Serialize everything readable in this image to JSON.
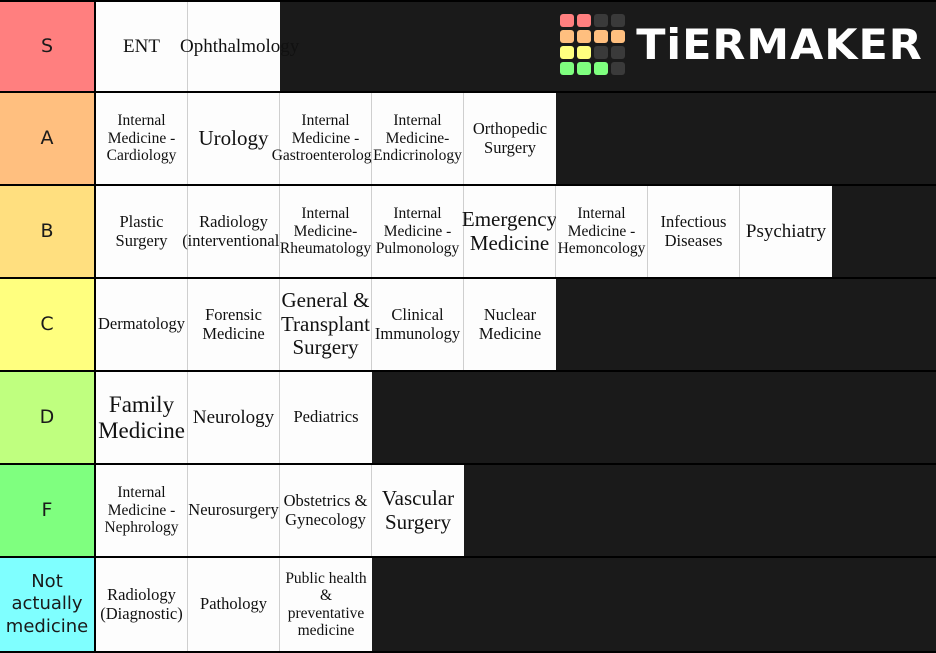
{
  "brand": {
    "name": "TiERMAKER",
    "logo_grid": [
      [
        "#ff7f7f",
        "#ff7f7f",
        "#3a3a3a",
        "#3a3a3a"
      ],
      [
        "#ffbf7f",
        "#ffbf7f",
        "#ffbf7f",
        "#ffbf7f"
      ],
      [
        "#ffff7f",
        "#ffff7f",
        "#3a3a3a",
        "#3a3a3a"
      ],
      [
        "#7fff7f",
        "#7fff7f",
        "#7fff7f",
        "#3a3a3a"
      ]
    ]
  },
  "background_color": "#1a1a1a",
  "tiers": [
    {
      "label": "S",
      "color": "#ff7f7f",
      "items": [
        {
          "text": "ENT",
          "size": "fs-15"
        },
        {
          "text": "Ophthalmology",
          "size": "fs-15"
        }
      ]
    },
    {
      "label": "A",
      "color": "#ffbf7f",
      "items": [
        {
          "text": "Internal Medicine - Cardiology",
          "size": "fs-12"
        },
        {
          "text": "Urology",
          "size": "fs-17"
        },
        {
          "text": "Internal Medicine - Gastroenterology",
          "size": "fs-12"
        },
        {
          "text": "Internal Medicine- Endicrinology",
          "size": "fs-12"
        },
        {
          "text": "Orthopedic Surgery",
          "size": "fs-13"
        }
      ]
    },
    {
      "label": "B",
      "color": "#ffdf7f",
      "items": [
        {
          "text": "Plastic Surgery",
          "size": "fs-13"
        },
        {
          "text": "Radiology (interventional)",
          "size": "fs-13"
        },
        {
          "text": "Internal Medicine- Rheumatology",
          "size": "fs-12"
        },
        {
          "text": "Internal Medicine - Pulmonology",
          "size": "fs-12"
        },
        {
          "text": "Emergency Medicine",
          "size": "fs-17"
        },
        {
          "text": "Internal Medicine - Hemoncology",
          "size": "fs-12"
        },
        {
          "text": "Infectious Diseases",
          "size": "fs-13"
        },
        {
          "text": "Psychiatry",
          "size": "fs-15"
        }
      ]
    },
    {
      "label": "C",
      "color": "#ffff7f",
      "items": [
        {
          "text": "Dermatology",
          "size": "fs-13"
        },
        {
          "text": "Forensic Medicine",
          "size": "fs-13"
        },
        {
          "text": "General & Transplant Surgery",
          "size": "fs-17"
        },
        {
          "text": "Clinical Immunology",
          "size": "fs-13"
        },
        {
          "text": "Nuclear Medicine",
          "size": "fs-13"
        }
      ]
    },
    {
      "label": "D",
      "color": "#bfff7f",
      "items": [
        {
          "text": "Family Medicine",
          "size": "fs-19"
        },
        {
          "text": "Neurology",
          "size": "fs-15"
        },
        {
          "text": "Pediatrics",
          "size": "fs-13"
        }
      ]
    },
    {
      "label": "F",
      "color": "#7fff7f",
      "items": [
        {
          "text": "Internal Medicine - Nephrology",
          "size": "fs-12"
        },
        {
          "text": "Neurosurgery",
          "size": "fs-13"
        },
        {
          "text": "Obstetrics & Gynecology",
          "size": "fs-13"
        },
        {
          "text": "Vascular Surgery",
          "size": "fs-17"
        }
      ]
    },
    {
      "label": "Not actually medicine",
      "color": "#7fffff",
      "items": [
        {
          "text": "Radiology (Diagnostic)",
          "size": "fs-13"
        },
        {
          "text": "Pathology",
          "size": "fs-13"
        },
        {
          "text": "Public health & preventative medicine",
          "size": "fs-12"
        }
      ]
    }
  ]
}
